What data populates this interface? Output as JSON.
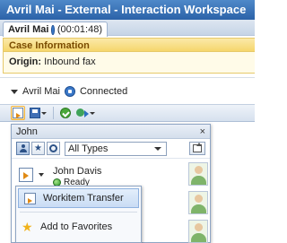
{
  "window": {
    "title": "Avril Mai - External - Interaction Workspace"
  },
  "tab": {
    "name": "Avril Mai",
    "duration": "(00:01:48)"
  },
  "case_info": {
    "header": "Case Information",
    "origin_label": "Origin:",
    "origin_value": "Inbound fax"
  },
  "interaction": {
    "party": "Avril Mai",
    "state": "Connected"
  },
  "transfer_popup": {
    "title": "John",
    "close_glyph": "×",
    "type_filter": "All Types",
    "contact": {
      "name": "John Davis",
      "status": "Ready"
    }
  },
  "context_menu": {
    "items": [
      {
        "label": "Workitem Transfer"
      },
      {
        "label": "Add to Favorites"
      }
    ]
  },
  "colors": {
    "title_bar": "#2b62a8",
    "case_header": "#f5d66c",
    "ready_status": "#2f9a2a",
    "favorite_star": "#f0b21b"
  }
}
